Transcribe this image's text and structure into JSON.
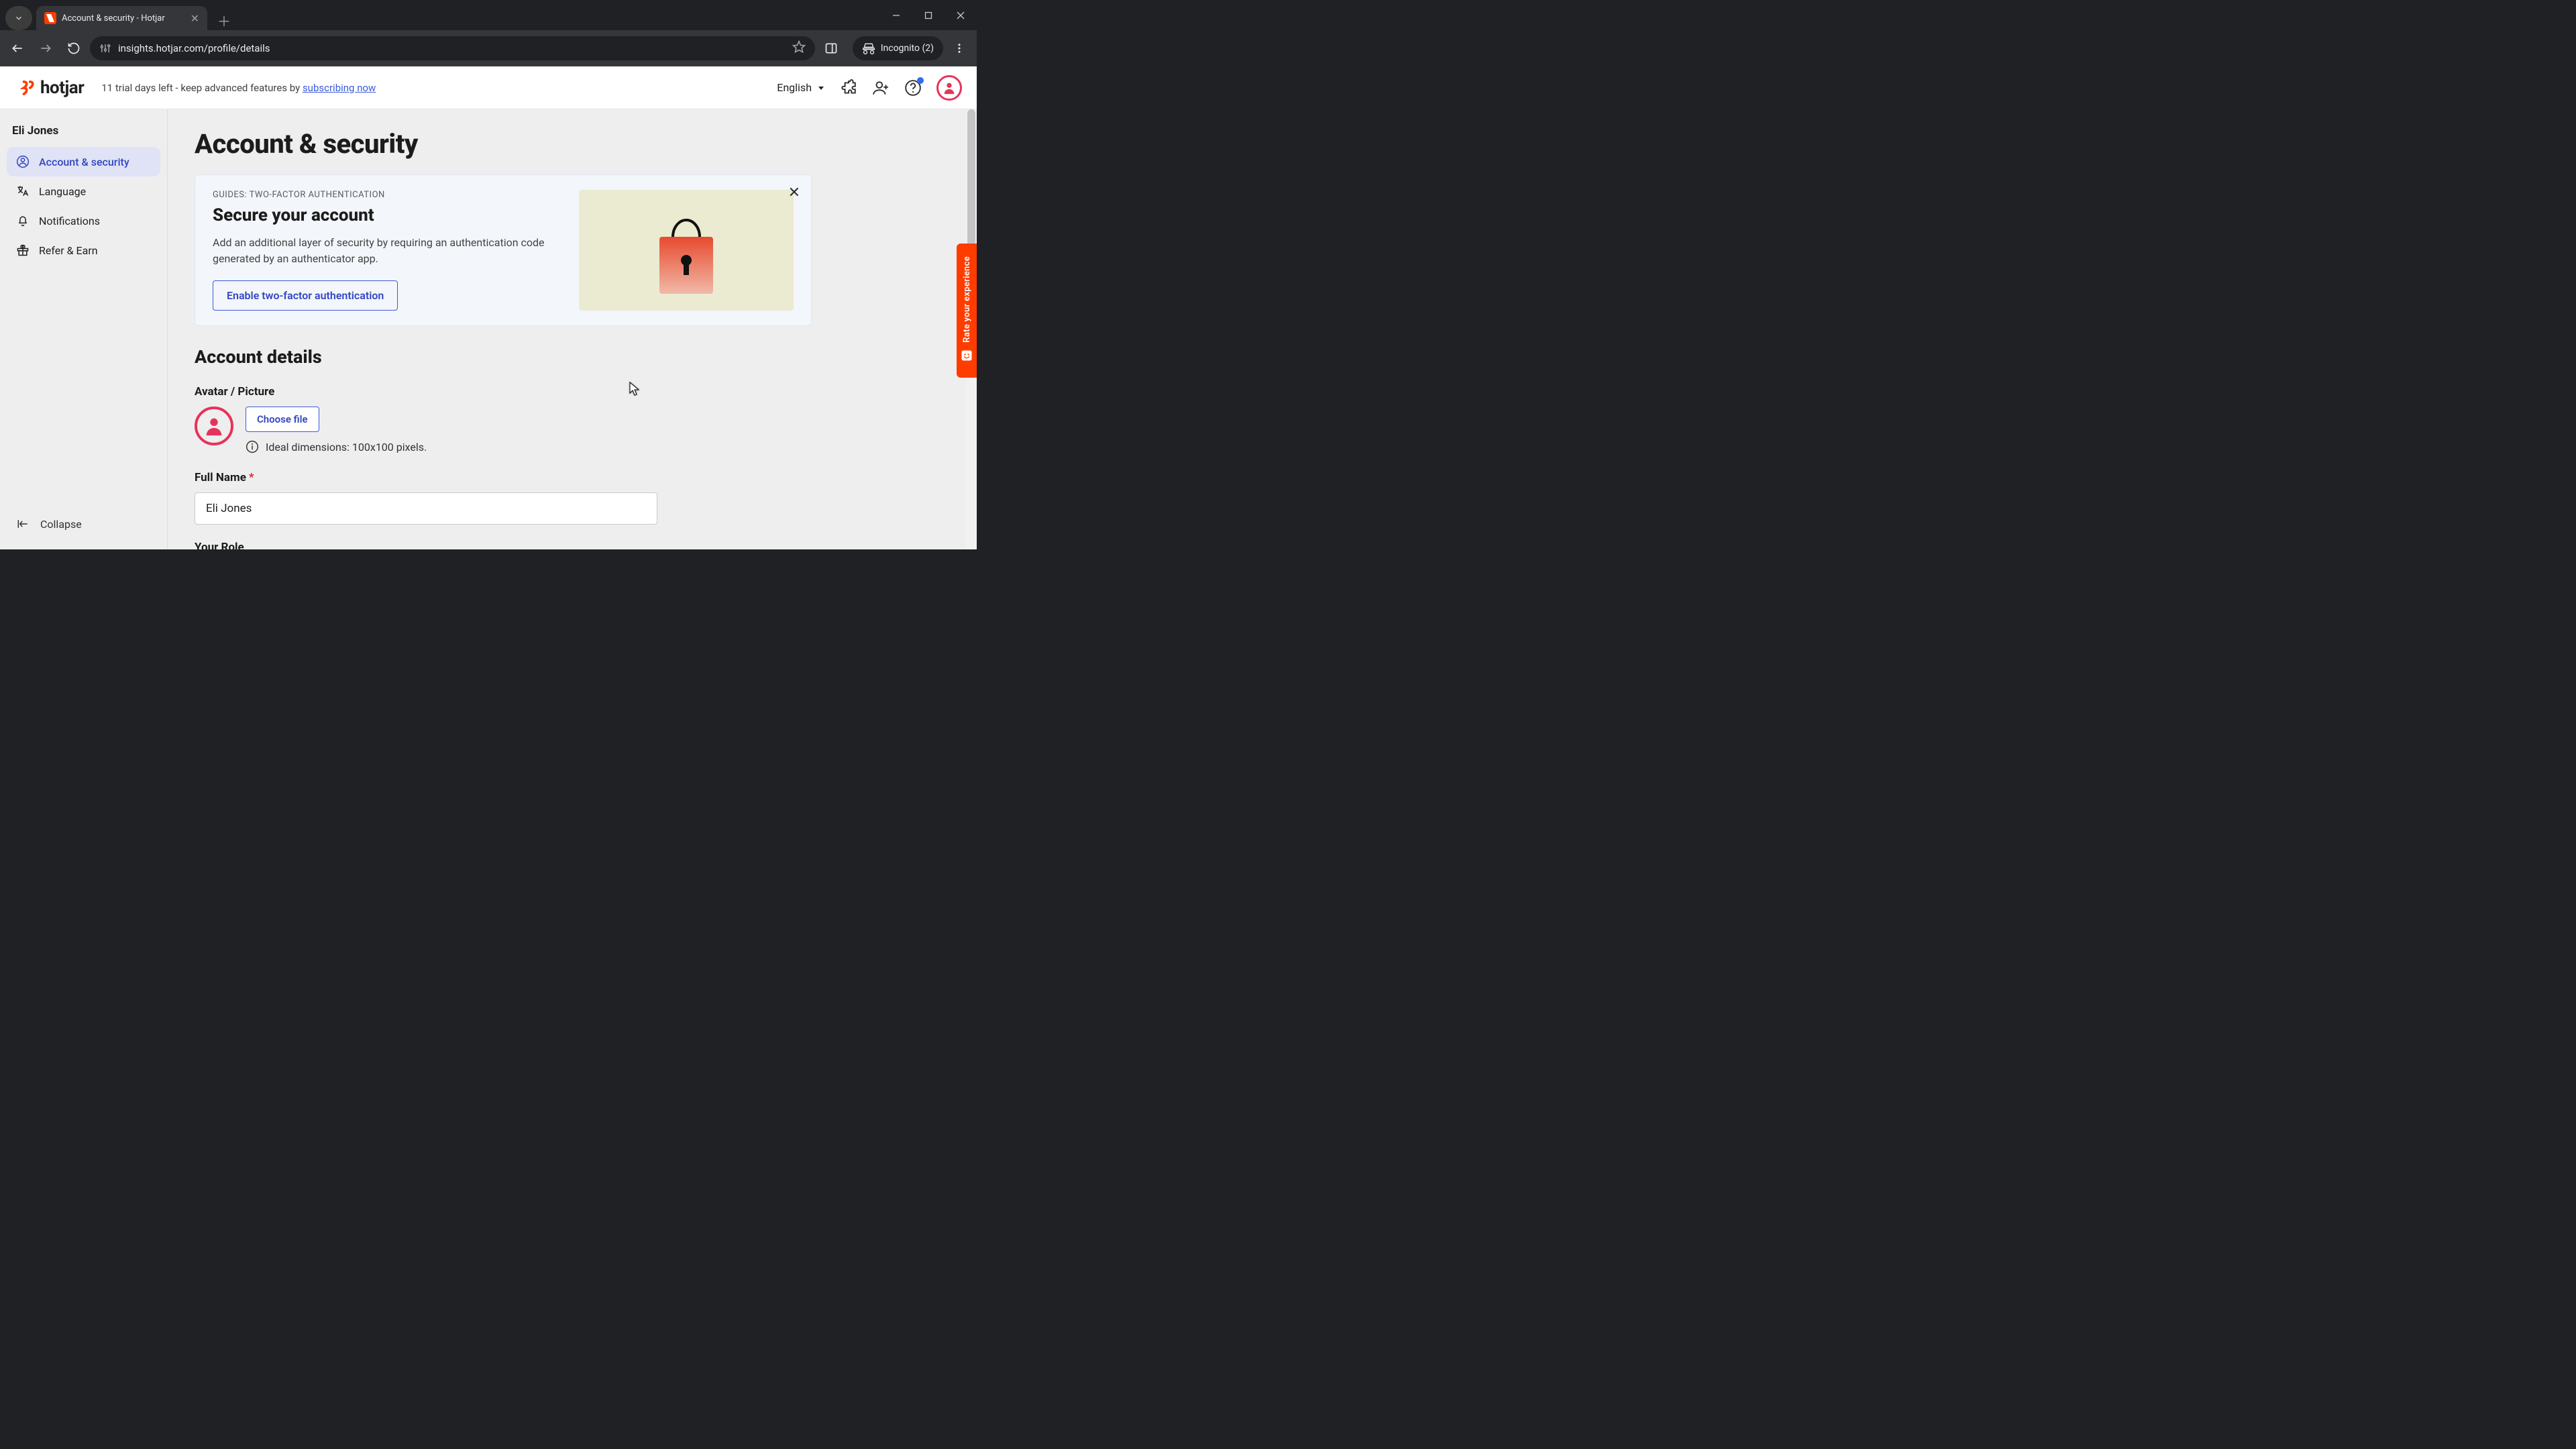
{
  "browser": {
    "tab_title": "Account & security - Hotjar",
    "url": "insights.hotjar.com/profile/details",
    "incognito_label": "Incognito (2)"
  },
  "header": {
    "logo_text": "hotjar",
    "trial_text_prefix": "11 trial days left - keep advanced features by ",
    "trial_link": "subscribing now",
    "language": "English"
  },
  "sidebar": {
    "user_name": "Eli Jones",
    "items": [
      {
        "label": "Account & security"
      },
      {
        "label": "Language"
      },
      {
        "label": "Notifications"
      },
      {
        "label": "Refer & Earn"
      }
    ],
    "collapse_label": "Collapse"
  },
  "page": {
    "title": "Account & security",
    "guide": {
      "eyebrow": "GUIDES: TWO-FACTOR AUTHENTICATION",
      "title": "Secure your account",
      "description": "Add an additional layer of security by requiring an authentication code generated by an authenticator app.",
      "cta": "Enable two-factor authentication"
    },
    "section_title": "Account details",
    "avatar_label": "Avatar / Picture",
    "choose_file": "Choose file",
    "avatar_hint": "Ideal dimensions: 100x100 pixels.",
    "full_name_label": "Full Name",
    "full_name_value": "Eli Jones",
    "role_label_partial": "Your Role"
  },
  "feedback_tab": "Rate your experience"
}
